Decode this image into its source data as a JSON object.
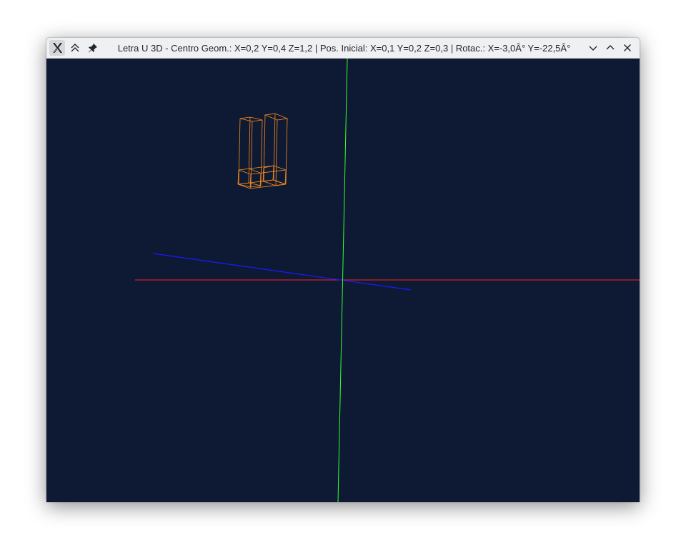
{
  "window": {
    "title": "Letra U 3D - Centro Geom.: X=0,2 Y=0,4 Z=1,2 | Pos. Inicial: X=0,1 Y=0,2 Z=0,3 | Rotac.: X=-3,0Â° Y=-22,5Â°"
  },
  "titlebar": {
    "left_icons": [
      "app-icon",
      "keep-above-icon",
      "pin-icon"
    ],
    "right_icons": [
      "minimize-icon",
      "maximize-icon",
      "close-icon"
    ]
  },
  "scene": {
    "background": "#0e1a33",
    "axis_colors": {
      "x": "#ff2020",
      "y": "#33ff33",
      "z": "#1a1aff"
    },
    "model_color": "#ff8c1a",
    "model": "letter-U-wireframe"
  }
}
